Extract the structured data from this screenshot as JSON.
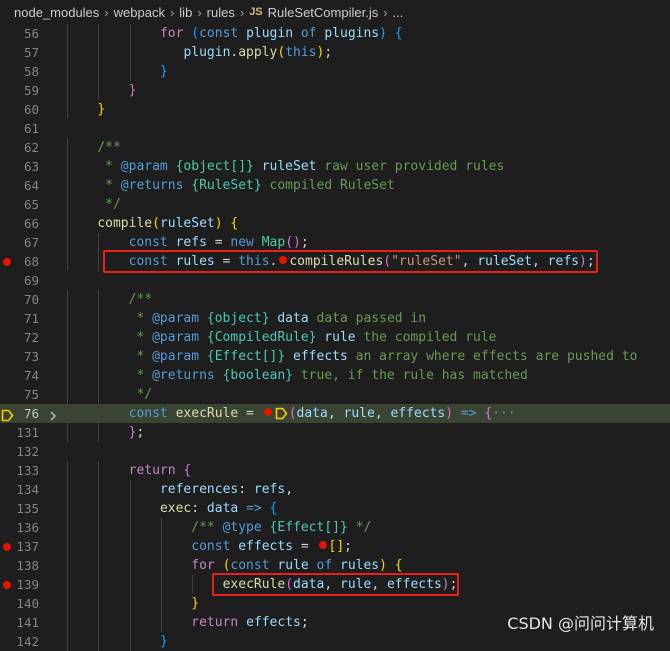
{
  "breadcrumb": [
    "node_modules",
    "webpack",
    "lib",
    "rules",
    "RuleSetCompiler.js",
    "..."
  ],
  "file_badge": "JS",
  "separator": "›",
  "lines": [
    {
      "num": "56",
      "tokens": [
        [
          "ctl",
          "for "
        ],
        [
          "br3",
          "("
        ],
        [
          "k",
          "const "
        ],
        [
          "v",
          "plugin "
        ],
        [
          "k",
          "of "
        ],
        [
          "v",
          "plugins"
        ],
        [
          "br3",
          ")"
        ],
        [
          "op",
          " "
        ],
        [
          "br3",
          "{"
        ]
      ]
    },
    {
      "num": "57",
      "tokens": [
        [
          "v",
          "plugin"
        ],
        [
          "op",
          "."
        ],
        [
          "fn",
          "apply"
        ],
        [
          "br1",
          "("
        ],
        [
          "k",
          "this"
        ],
        [
          "br1",
          ")"
        ],
        [
          "op",
          ";"
        ]
      ]
    },
    {
      "num": "58",
      "tokens": [
        [
          "br3",
          "}"
        ]
      ]
    },
    {
      "num": "59",
      "tokens": [
        [
          "br2",
          "}"
        ]
      ]
    },
    {
      "num": "60",
      "tokens": [
        [
          "br1",
          "}"
        ]
      ]
    },
    {
      "num": "61",
      "tokens": []
    },
    {
      "num": "62",
      "tokens": [
        [
          "cm",
          "/**"
        ]
      ]
    },
    {
      "num": "63",
      "tokens": [
        [
          "cm",
          " * "
        ],
        [
          "k",
          "@param "
        ],
        [
          "ct",
          "{object[]}"
        ],
        [
          "v",
          " ruleSet"
        ],
        [
          "cm",
          " raw user provided rules"
        ]
      ]
    },
    {
      "num": "64",
      "tokens": [
        [
          "cm",
          " * "
        ],
        [
          "k",
          "@returns "
        ],
        [
          "ct",
          "{RuleSet}"
        ],
        [
          "cm",
          " compiled RuleSet"
        ]
      ]
    },
    {
      "num": "65",
      "tokens": [
        [
          "cm",
          " */"
        ]
      ]
    },
    {
      "num": "66",
      "tokens": [
        [
          "fn",
          "compile"
        ],
        [
          "br1",
          "("
        ],
        [
          "v",
          "ruleSet"
        ],
        [
          "br1",
          ")"
        ],
        [
          "op",
          " "
        ],
        [
          "br1",
          "{"
        ]
      ]
    },
    {
      "num": "67",
      "tokens": [
        [
          "k",
          "const "
        ],
        [
          "v",
          "refs"
        ],
        [
          "op",
          " = "
        ],
        [
          "k",
          "new "
        ],
        [
          "cls",
          "Map"
        ],
        [
          "br2",
          "("
        ],
        [
          "br2",
          ")"
        ],
        [
          "op",
          ";"
        ]
      ]
    },
    {
      "num": "68",
      "tokens": [
        [
          "k",
          "const "
        ],
        [
          "v",
          "rules"
        ],
        [
          "op",
          " = "
        ],
        [
          "k",
          "this"
        ],
        [
          "op",
          "."
        ],
        [
          "bp",
          ""
        ],
        [
          "fn",
          "compileRules"
        ],
        [
          "br2",
          "("
        ],
        [
          "str",
          "\"ruleSet\""
        ],
        [
          "op",
          ", "
        ],
        [
          "v",
          "ruleSet"
        ],
        [
          "op",
          ", "
        ],
        [
          "v",
          "refs"
        ],
        [
          "br2",
          ")"
        ],
        [
          "op",
          ";"
        ]
      ]
    },
    {
      "num": "69",
      "tokens": []
    },
    {
      "num": "70",
      "tokens": [
        [
          "cm",
          "/**"
        ]
      ]
    },
    {
      "num": "71",
      "tokens": [
        [
          "cm",
          " * "
        ],
        [
          "k",
          "@param "
        ],
        [
          "ct",
          "{object}"
        ],
        [
          "v",
          " data"
        ],
        [
          "cm",
          " data passed in"
        ]
      ]
    },
    {
      "num": "72",
      "tokens": [
        [
          "cm",
          " * "
        ],
        [
          "k",
          "@param "
        ],
        [
          "ct",
          "{CompiledRule}"
        ],
        [
          "v",
          " rule"
        ],
        [
          "cm",
          " the compiled rule"
        ]
      ]
    },
    {
      "num": "73",
      "tokens": [
        [
          "cm",
          " * "
        ],
        [
          "k",
          "@param "
        ],
        [
          "ct",
          "{Effect[]}"
        ],
        [
          "v",
          " effects"
        ],
        [
          "cm",
          " an array where effects are pushed to"
        ]
      ]
    },
    {
      "num": "74",
      "tokens": [
        [
          "cm",
          " * "
        ],
        [
          "k",
          "@returns "
        ],
        [
          "ct",
          "{boolean}"
        ],
        [
          "cm",
          " true, if the rule has matched"
        ]
      ]
    },
    {
      "num": "75",
      "tokens": [
        [
          "cm",
          " */"
        ]
      ]
    },
    {
      "num": "76",
      "tokens": [
        [
          "k",
          "const "
        ],
        [
          "fn",
          "execRule"
        ],
        [
          "op",
          " = "
        ],
        [
          "bp",
          ""
        ],
        [
          "bparrow",
          ""
        ],
        [
          "br2",
          "("
        ],
        [
          "v",
          "data"
        ],
        [
          "op",
          ", "
        ],
        [
          "v",
          "rule"
        ],
        [
          "op",
          ", "
        ],
        [
          "v",
          "effects"
        ],
        [
          "br2",
          ")"
        ],
        [
          "op",
          " "
        ],
        [
          "k",
          "=>"
        ],
        [
          "op",
          " "
        ],
        [
          "br2",
          "{"
        ],
        [
          "ellip",
          "···"
        ]
      ]
    },
    {
      "num": "131",
      "tokens": [
        [
          "br2",
          "}"
        ],
        [
          "op",
          ";"
        ]
      ]
    },
    {
      "num": "132",
      "tokens": []
    },
    {
      "num": "133",
      "tokens": [
        [
          "ctl",
          "return "
        ],
        [
          "br2",
          "{"
        ]
      ]
    },
    {
      "num": "134",
      "tokens": [
        [
          "v",
          "references"
        ],
        [
          "op",
          ": "
        ],
        [
          "v",
          "refs"
        ],
        [
          "op",
          ","
        ]
      ]
    },
    {
      "num": "135",
      "tokens": [
        [
          "fn",
          "exec"
        ],
        [
          "op",
          ": "
        ],
        [
          "v",
          "data"
        ],
        [
          "op",
          " "
        ],
        [
          "k",
          "=>"
        ],
        [
          "op",
          " "
        ],
        [
          "br3",
          "{"
        ]
      ]
    },
    {
      "num": "136",
      "tokens": [
        [
          "cm",
          "/** "
        ],
        [
          "k",
          "@type "
        ],
        [
          "ct",
          "{Effect[]}"
        ],
        [
          "cm",
          " */"
        ]
      ]
    },
    {
      "num": "137",
      "tokens": [
        [
          "k",
          "const "
        ],
        [
          "v",
          "effects"
        ],
        [
          "op",
          " = "
        ],
        [
          "bp",
          ""
        ],
        [
          "br1",
          "["
        ],
        [
          "br1",
          "]"
        ],
        [
          "op",
          ";"
        ]
      ]
    },
    {
      "num": "138",
      "tokens": [
        [
          "ctl",
          "for "
        ],
        [
          "br1",
          "("
        ],
        [
          "k",
          "const "
        ],
        [
          "v",
          "rule "
        ],
        [
          "k",
          "of "
        ],
        [
          "v",
          "rules"
        ],
        [
          "br1",
          ")"
        ],
        [
          "op",
          " "
        ],
        [
          "br1",
          "{"
        ]
      ]
    },
    {
      "num": "139",
      "tokens": [
        [
          "fn",
          "execRule"
        ],
        [
          "br2",
          "("
        ],
        [
          "v",
          "data"
        ],
        [
          "op",
          ", "
        ],
        [
          "v",
          "rule"
        ],
        [
          "op",
          ", "
        ],
        [
          "v",
          "effects"
        ],
        [
          "br2",
          ")"
        ],
        [
          "op",
          ";"
        ]
      ]
    },
    {
      "num": "140",
      "tokens": [
        [
          "br1",
          "}"
        ]
      ]
    },
    {
      "num": "141",
      "tokens": [
        [
          "ctl",
          "return "
        ],
        [
          "v",
          "effects"
        ],
        [
          "op",
          ";"
        ]
      ]
    },
    {
      "num": "142",
      "tokens": [
        [
          "br3",
          "}"
        ]
      ]
    }
  ],
  "breakpoints": [
    "68",
    "137",
    "139"
  ],
  "current_line": "76",
  "collapsed_line": "76",
  "highlight_boxes": [
    "68",
    "139"
  ],
  "watermark": "CSDN @问问计算机",
  "colors": {
    "breakpoint": "#e51400",
    "current_line": "#3a4433",
    "highlight_box": "#e8211b",
    "current_arrow": "#ffcc00"
  }
}
